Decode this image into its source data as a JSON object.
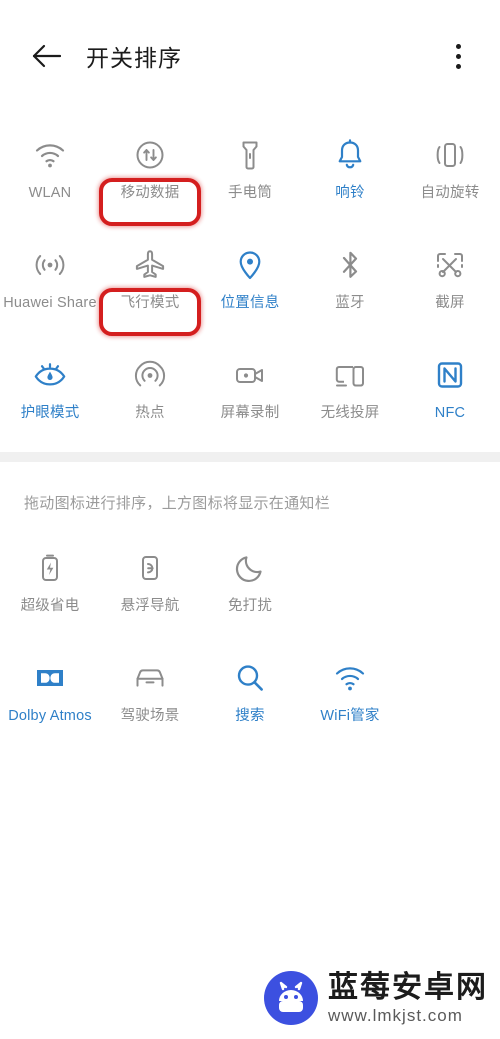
{
  "header": {
    "back_icon": "back-arrow-icon",
    "title": "开关排序",
    "menu_icon": "overflow-menu-icon"
  },
  "colors": {
    "active": "#2f80c8",
    "inactive": "#8c8c8c",
    "highlight": "#d41f1f",
    "background": "#ffffff",
    "divider": "#f0f0f0"
  },
  "top_grid": {
    "items": [
      {
        "label": "WLAN",
        "icon": "wifi-icon",
        "state": "off",
        "highlighted": false
      },
      {
        "label": "移动数据",
        "icon": "mobile-data-icon",
        "state": "off",
        "highlighted": true
      },
      {
        "label": "手电筒",
        "icon": "flashlight-icon",
        "state": "off",
        "highlighted": false
      },
      {
        "label": "响铃",
        "icon": "bell-icon",
        "state": "on",
        "highlighted": false
      },
      {
        "label": "自动旋转",
        "icon": "auto-rotate-icon",
        "state": "off",
        "highlighted": false
      },
      {
        "label": "Huawei Share",
        "icon": "huawei-share-icon",
        "state": "off",
        "highlighted": false
      },
      {
        "label": "飞行模式",
        "icon": "airplane-mode-icon",
        "state": "off",
        "highlighted": true
      },
      {
        "label": "位置信息",
        "icon": "location-pin-icon",
        "state": "on",
        "highlighted": false
      },
      {
        "label": "蓝牙",
        "icon": "bluetooth-icon",
        "state": "off",
        "highlighted": false
      },
      {
        "label": "截屏",
        "icon": "screenshot-icon",
        "state": "off",
        "highlighted": false
      },
      {
        "label": "护眼模式",
        "icon": "eye-comfort-icon",
        "state": "on",
        "highlighted": false
      },
      {
        "label": "热点",
        "icon": "hotspot-icon",
        "state": "off",
        "highlighted": false
      },
      {
        "label": "屏幕录制",
        "icon": "screen-record-icon",
        "state": "off",
        "highlighted": false
      },
      {
        "label": "无线投屏",
        "icon": "cast-screen-icon",
        "state": "off",
        "highlighted": false
      },
      {
        "label": "NFC",
        "icon": "nfc-icon",
        "state": "on",
        "highlighted": false
      }
    ]
  },
  "hint": "拖动图标进行排序，上方图标将显示在通知栏",
  "bottom_grid": {
    "items": [
      {
        "label": "超级省电",
        "icon": "ultra-power-saving-icon",
        "state": "off"
      },
      {
        "label": "悬浮导航",
        "icon": "floating-nav-icon",
        "state": "off"
      },
      {
        "label": "免打扰",
        "icon": "do-not-disturb-icon",
        "state": "off"
      },
      {
        "label": "",
        "icon": "",
        "state": "empty"
      },
      {
        "label": "",
        "icon": "",
        "state": "empty"
      },
      {
        "label": "Dolby Atmos",
        "icon": "dolby-atmos-icon",
        "state": "on"
      },
      {
        "label": "驾驶场景",
        "icon": "driving-mode-icon",
        "state": "off"
      },
      {
        "label": "搜索",
        "icon": "search-icon",
        "state": "on"
      },
      {
        "label": "WiFi管家",
        "icon": "wifi-manager-icon",
        "state": "on"
      },
      {
        "label": "",
        "icon": "",
        "state": "empty"
      }
    ]
  },
  "watermark": {
    "logo_icon": "blueberry-android-logo-icon",
    "title": "蓝莓安卓网",
    "url": "www.lmkjst.com"
  }
}
